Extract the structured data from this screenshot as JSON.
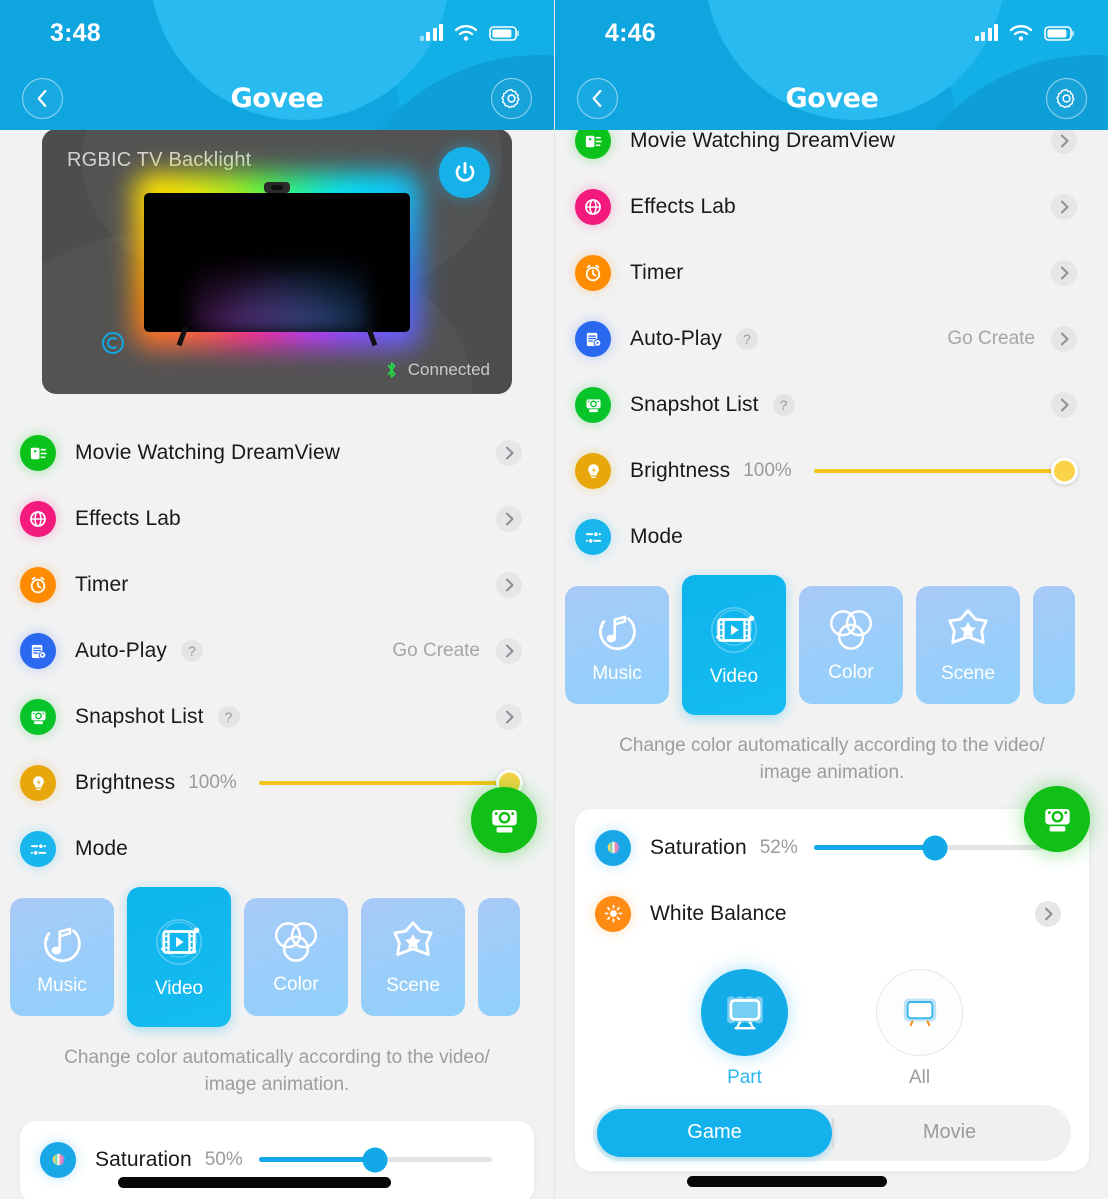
{
  "left": {
    "statusbar": {
      "time": "3:48"
    },
    "nav": {
      "brand": "Govee",
      "back_icon": "chevron-left-icon",
      "settings_icon": "gear-icon"
    },
    "device": {
      "name": "RGBIC TV Backlight",
      "connection": "Connected",
      "power_icon": "power-icon",
      "bluetooth_icon": "bluetooth-icon"
    },
    "rows": [
      {
        "label": "Movie Watching DreamView",
        "icon": "dreamview-icon",
        "color": "green",
        "value": "",
        "help": false
      },
      {
        "label": "Effects Lab",
        "icon": "globe-icon",
        "color": "pink",
        "value": "",
        "help": false
      },
      {
        "label": "Timer",
        "icon": "alarm-clock-icon",
        "color": "orange",
        "value": "",
        "help": false
      },
      {
        "label": "Auto-Play",
        "icon": "autoplay-icon",
        "color": "blue",
        "value": "Go Create",
        "help": true
      },
      {
        "label": "Snapshot List",
        "icon": "snapshot-icon",
        "color": "green2",
        "value": "",
        "help": true
      }
    ],
    "brightness": {
      "label": "Brightness",
      "value": "100%",
      "percent": 100,
      "icon": "bulb-icon"
    },
    "mode": {
      "label": "Mode",
      "icon": "sliders-icon"
    },
    "tiles": [
      {
        "label": "Music",
        "icon": "music-note-icon",
        "active": false
      },
      {
        "label": "Video",
        "icon": "film-play-icon",
        "active": true
      },
      {
        "label": "Color",
        "icon": "color-circles-icon",
        "active": false
      },
      {
        "label": "Scene",
        "icon": "star-icon",
        "active": false
      }
    ],
    "description": "Change color automatically according to the video/ image animation.",
    "saturation": {
      "label": "Saturation",
      "value": "50%",
      "percent": 50,
      "icon": "saturation-icon"
    },
    "fab": {
      "icon": "camera-capture-icon"
    },
    "help_glyph": "?"
  },
  "right": {
    "statusbar": {
      "time": "4:46"
    },
    "nav": {
      "brand": "Govee",
      "back_icon": "chevron-left-icon",
      "settings_icon": "gear-icon"
    },
    "rows": [
      {
        "label": "Movie Watching DreamView",
        "icon": "dreamview-icon",
        "color": "green",
        "value": "",
        "help": false
      },
      {
        "label": "Effects Lab",
        "icon": "globe-icon",
        "color": "pink",
        "value": "",
        "help": false
      },
      {
        "label": "Timer",
        "icon": "alarm-clock-icon",
        "color": "orange",
        "value": "",
        "help": false
      },
      {
        "label": "Auto-Play",
        "icon": "autoplay-icon",
        "color": "blue",
        "value": "Go Create",
        "help": true
      },
      {
        "label": "Snapshot List",
        "icon": "snapshot-icon",
        "color": "green2",
        "value": "",
        "help": true
      }
    ],
    "brightness": {
      "label": "Brightness",
      "value": "100%",
      "percent": 100,
      "icon": "bulb-icon"
    },
    "mode": {
      "label": "Mode",
      "icon": "sliders-icon"
    },
    "tiles": [
      {
        "label": "Music",
        "icon": "music-note-icon",
        "active": false
      },
      {
        "label": "Video",
        "icon": "film-play-icon",
        "active": true
      },
      {
        "label": "Color",
        "icon": "color-circles-icon",
        "active": false
      },
      {
        "label": "Scene",
        "icon": "star-icon",
        "active": false
      }
    ],
    "description": "Change color automatically according to the video/ image animation.",
    "saturation": {
      "label": "Saturation",
      "value": "52%",
      "percent": 52,
      "icon": "saturation-icon"
    },
    "white_balance": {
      "label": "White Balance",
      "icon": "sun-icon"
    },
    "capture_area": [
      {
        "label": "Part",
        "icon": "tv-part-icon",
        "selected": true
      },
      {
        "label": "All",
        "icon": "tv-all-icon",
        "selected": false
      }
    ],
    "segments": [
      {
        "label": "Game",
        "active": true
      },
      {
        "label": "Movie",
        "active": false
      }
    ],
    "fab": {
      "icon": "camera-capture-icon"
    },
    "help_glyph": "?"
  },
  "colors": {
    "brand_blue": "#13b0e8",
    "accent_yellow": "#fad349",
    "slider_blue": "#13a9e8",
    "fab_green": "#11c016"
  }
}
